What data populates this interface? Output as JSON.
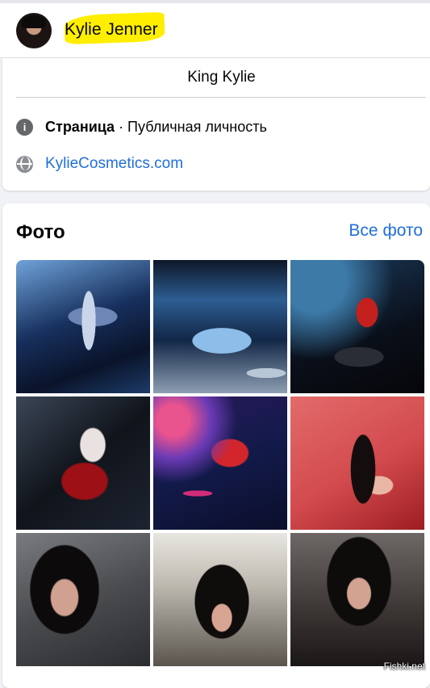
{
  "header": {
    "name": "Kylie Jenner"
  },
  "intro": {
    "bio": "King Kylie",
    "category_label": "Страница",
    "category_value": " · Публичная личность",
    "website": "KylieCosmetics.com",
    "info_icon": "info-icon",
    "globe_icon": "globe-icon"
  },
  "photos": {
    "title": "Фото",
    "see_all": "Все фото",
    "tiles": [
      "photo-1",
      "photo-2",
      "photo-3",
      "photo-4",
      "photo-5",
      "photo-6",
      "photo-7",
      "photo-8",
      "photo-9"
    ]
  },
  "watermark": "Fishki.net",
  "colors": {
    "link": "#216fdb",
    "highlight": "#ffee00",
    "background": "#f0f2f5"
  }
}
